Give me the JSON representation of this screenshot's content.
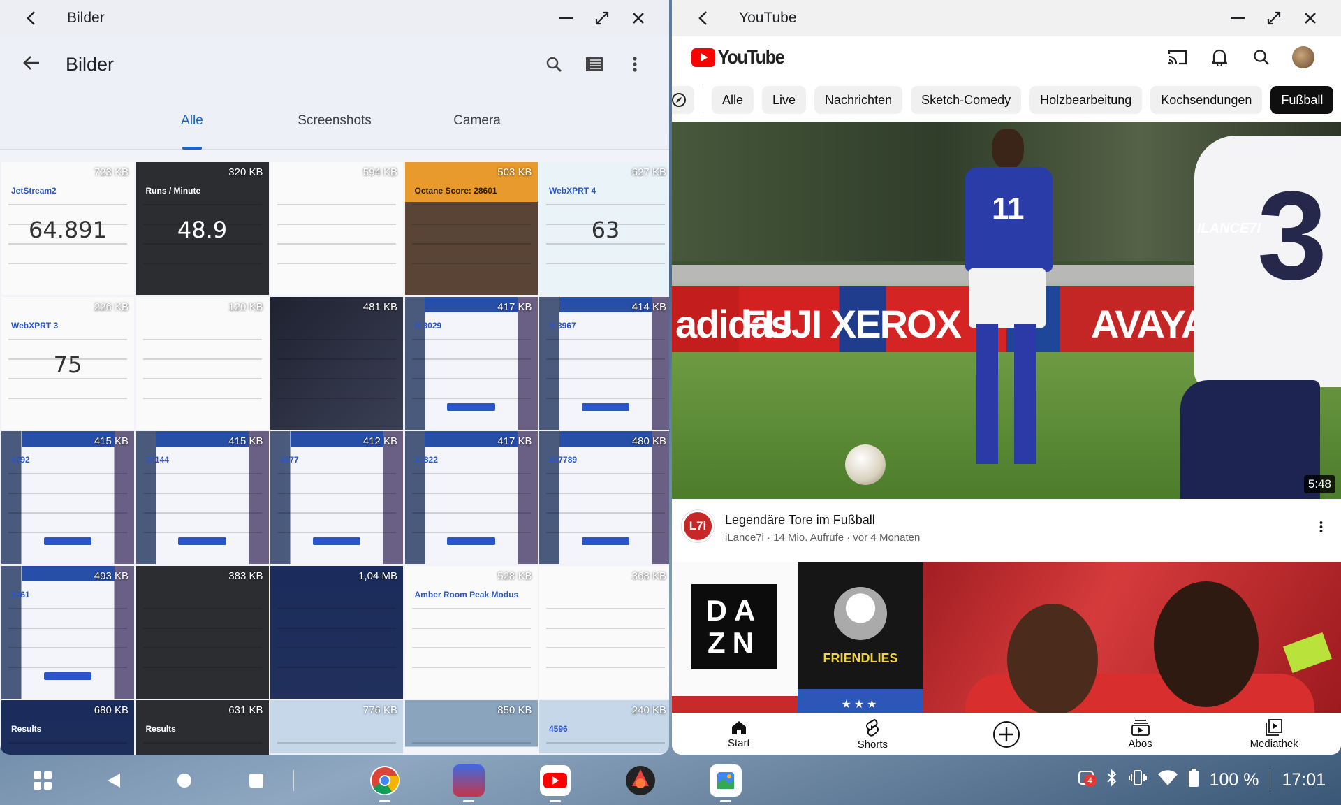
{
  "gallery": {
    "window_title": "Bilder",
    "app_title": "Bilder",
    "tabs": [
      {
        "label": "Alle",
        "active": true
      },
      {
        "label": "Screenshots",
        "active": false
      },
      {
        "label": "Camera",
        "active": false
      }
    ],
    "tiles": [
      {
        "size": "723 KB",
        "style": "t-white",
        "text": "JetStream2",
        "num": "64.891"
      },
      {
        "size": "320 KB",
        "style": "t-dark",
        "text": "Runs / Minute",
        "num": "48.9"
      },
      {
        "size": "594 KB",
        "style": "t-white",
        "text": "",
        "num": ""
      },
      {
        "size": "503 KB",
        "style": "t-orange",
        "text": "Octane Score: 28601",
        "num": ""
      },
      {
        "size": "627 KB",
        "style": "t-light",
        "text": "WebXPRT 4",
        "num": "63"
      },
      {
        "size": "226 KB",
        "style": "t-white",
        "text": "WebXPRT 3",
        "num": "75"
      },
      {
        "size": "120 KB",
        "style": "t-white",
        "text": "",
        "num": ""
      },
      {
        "size": "481 KB",
        "style": "t-dark2",
        "text": "",
        "num": ""
      },
      {
        "size": "417 KB",
        "style": "t-blue",
        "text": "N 3029",
        "num": ""
      },
      {
        "size": "414 KB",
        "style": "t-blue",
        "text": "N 3967",
        "num": ""
      },
      {
        "size": "415 KB",
        "style": "t-blue",
        "text": "4392",
        "num": ""
      },
      {
        "size": "415 KB",
        "style": "t-blue",
        "text": "37144",
        "num": ""
      },
      {
        "size": "412 KB",
        "style": "t-blue",
        "text": "4577",
        "num": ""
      },
      {
        "size": "417 KB",
        "style": "t-blue",
        "text": "31822",
        "num": ""
      },
      {
        "size": "480 KB",
        "style": "t-blue",
        "text": "607789",
        "num": ""
      },
      {
        "size": "493 KB",
        "style": "t-blue",
        "text": "8461",
        "num": ""
      },
      {
        "size": "383 KB",
        "style": "t-dark",
        "text": "",
        "num": ""
      },
      {
        "size": "1,04 MB",
        "style": "t-navy",
        "text": "",
        "num": ""
      },
      {
        "size": "528 KB",
        "style": "t-white",
        "text": "Amber Room Peak Modus",
        "num": ""
      },
      {
        "size": "368 KB",
        "style": "t-white",
        "text": "",
        "num": ""
      },
      {
        "size": "680 KB",
        "style": "t-navy",
        "text": "Results",
        "num": ""
      },
      {
        "size": "631 KB",
        "style": "t-dark",
        "text": "Results",
        "num": ""
      },
      {
        "size": "776 KB",
        "style": "t-ice",
        "text": "",
        "num": ""
      },
      {
        "size": "850 KB",
        "style": "t-ice2",
        "text": "",
        "num": ""
      },
      {
        "size": "240 KB",
        "style": "t-ice",
        "text": "4596",
        "num": ""
      }
    ]
  },
  "youtube": {
    "window_title": "YouTube",
    "logo_text": "YouTube",
    "chips": [
      {
        "label": "Alle",
        "active": false
      },
      {
        "label": "Live",
        "active": false
      },
      {
        "label": "Nachrichten",
        "active": false
      },
      {
        "label": "Sketch-Comedy",
        "active": false
      },
      {
        "label": "Holzbearbeitung",
        "active": false
      },
      {
        "label": "Kochsendungen",
        "active": false
      },
      {
        "label": "Fußball",
        "active": true
      }
    ],
    "video": {
      "duration": "5:48",
      "watermark": "ILANCE7I",
      "boards": [
        "adidas",
        "FUJI XEROX",
        "AVAYA"
      ],
      "title": "Legendäre Tore im Fußball",
      "subtitle": "iLance7i · 14 Mio. Aufrufe · vor 4 Monaten",
      "channel_badge": "L7i"
    },
    "video2": {
      "dazn": [
        "DA",
        "ZN"
      ],
      "friendlies": "FRIENDLIES",
      "stars": "★★★"
    },
    "nav": [
      {
        "label": "Start",
        "icon": "home-icon"
      },
      {
        "label": "Shorts",
        "icon": "shorts-icon"
      },
      {
        "label": "",
        "icon": "create-icon"
      },
      {
        "label": "Abos",
        "icon": "subscriptions-icon"
      },
      {
        "label": "Mediathek",
        "icon": "library-icon"
      }
    ]
  },
  "taskbar": {
    "notification_count": "4",
    "battery": "100 %",
    "time": "17:01"
  }
}
